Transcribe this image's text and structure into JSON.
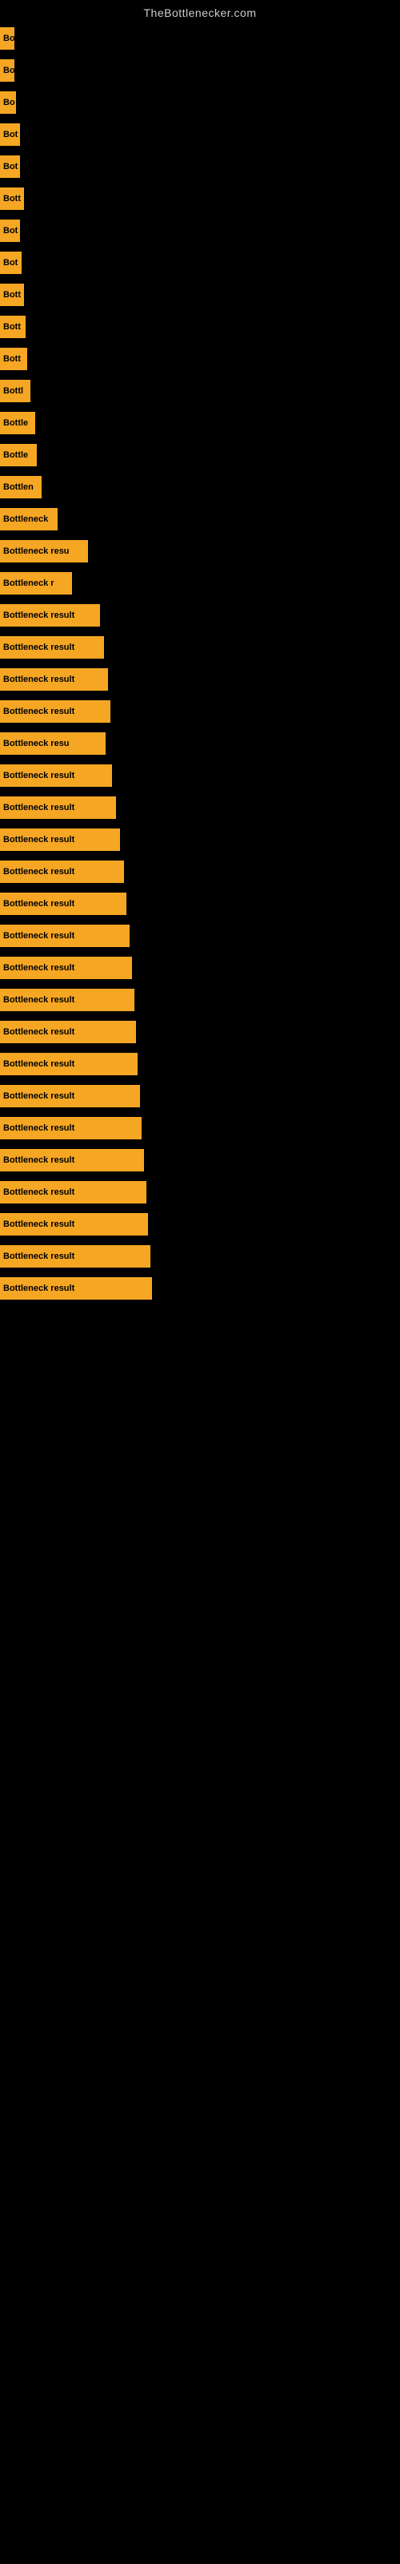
{
  "site": {
    "title": "TheBottlenecker.com"
  },
  "bars": [
    {
      "label": "Bo",
      "width": 18
    },
    {
      "label": "Bo",
      "width": 18
    },
    {
      "label": "Bo",
      "width": 20
    },
    {
      "label": "Bot",
      "width": 25
    },
    {
      "label": "Bot",
      "width": 25
    },
    {
      "label": "Bott",
      "width": 30
    },
    {
      "label": "Bot",
      "width": 25
    },
    {
      "label": "Bot",
      "width": 27
    },
    {
      "label": "Bott",
      "width": 30
    },
    {
      "label": "Bott",
      "width": 32
    },
    {
      "label": "Bott",
      "width": 34
    },
    {
      "label": "Bottl",
      "width": 38
    },
    {
      "label": "Bottle",
      "width": 44
    },
    {
      "label": "Bottle",
      "width": 46
    },
    {
      "label": "Bottlen",
      "width": 52
    },
    {
      "label": "Bottleneck",
      "width": 72
    },
    {
      "label": "Bottleneck resu",
      "width": 110
    },
    {
      "label": "Bottleneck r",
      "width": 90
    },
    {
      "label": "Bottleneck result",
      "width": 125
    },
    {
      "label": "Bottleneck result",
      "width": 130
    },
    {
      "label": "Bottleneck result",
      "width": 135
    },
    {
      "label": "Bottleneck result",
      "width": 138
    },
    {
      "label": "Bottleneck resu",
      "width": 132
    },
    {
      "label": "Bottleneck result",
      "width": 140
    },
    {
      "label": "Bottleneck result",
      "width": 145
    },
    {
      "label": "Bottleneck result",
      "width": 150
    },
    {
      "label": "Bottleneck result",
      "width": 155
    },
    {
      "label": "Bottleneck result",
      "width": 158
    },
    {
      "label": "Bottleneck result",
      "width": 162
    },
    {
      "label": "Bottleneck result",
      "width": 165
    },
    {
      "label": "Bottleneck result",
      "width": 168
    },
    {
      "label": "Bottleneck result",
      "width": 170
    },
    {
      "label": "Bottleneck result",
      "width": 172
    },
    {
      "label": "Bottleneck result",
      "width": 175
    },
    {
      "label": "Bottleneck result",
      "width": 177
    },
    {
      "label": "Bottleneck result",
      "width": 180
    },
    {
      "label": "Bottleneck result",
      "width": 183
    },
    {
      "label": "Bottleneck result",
      "width": 185
    },
    {
      "label": "Bottleneck result",
      "width": 188
    },
    {
      "label": "Bottleneck result",
      "width": 190
    }
  ]
}
